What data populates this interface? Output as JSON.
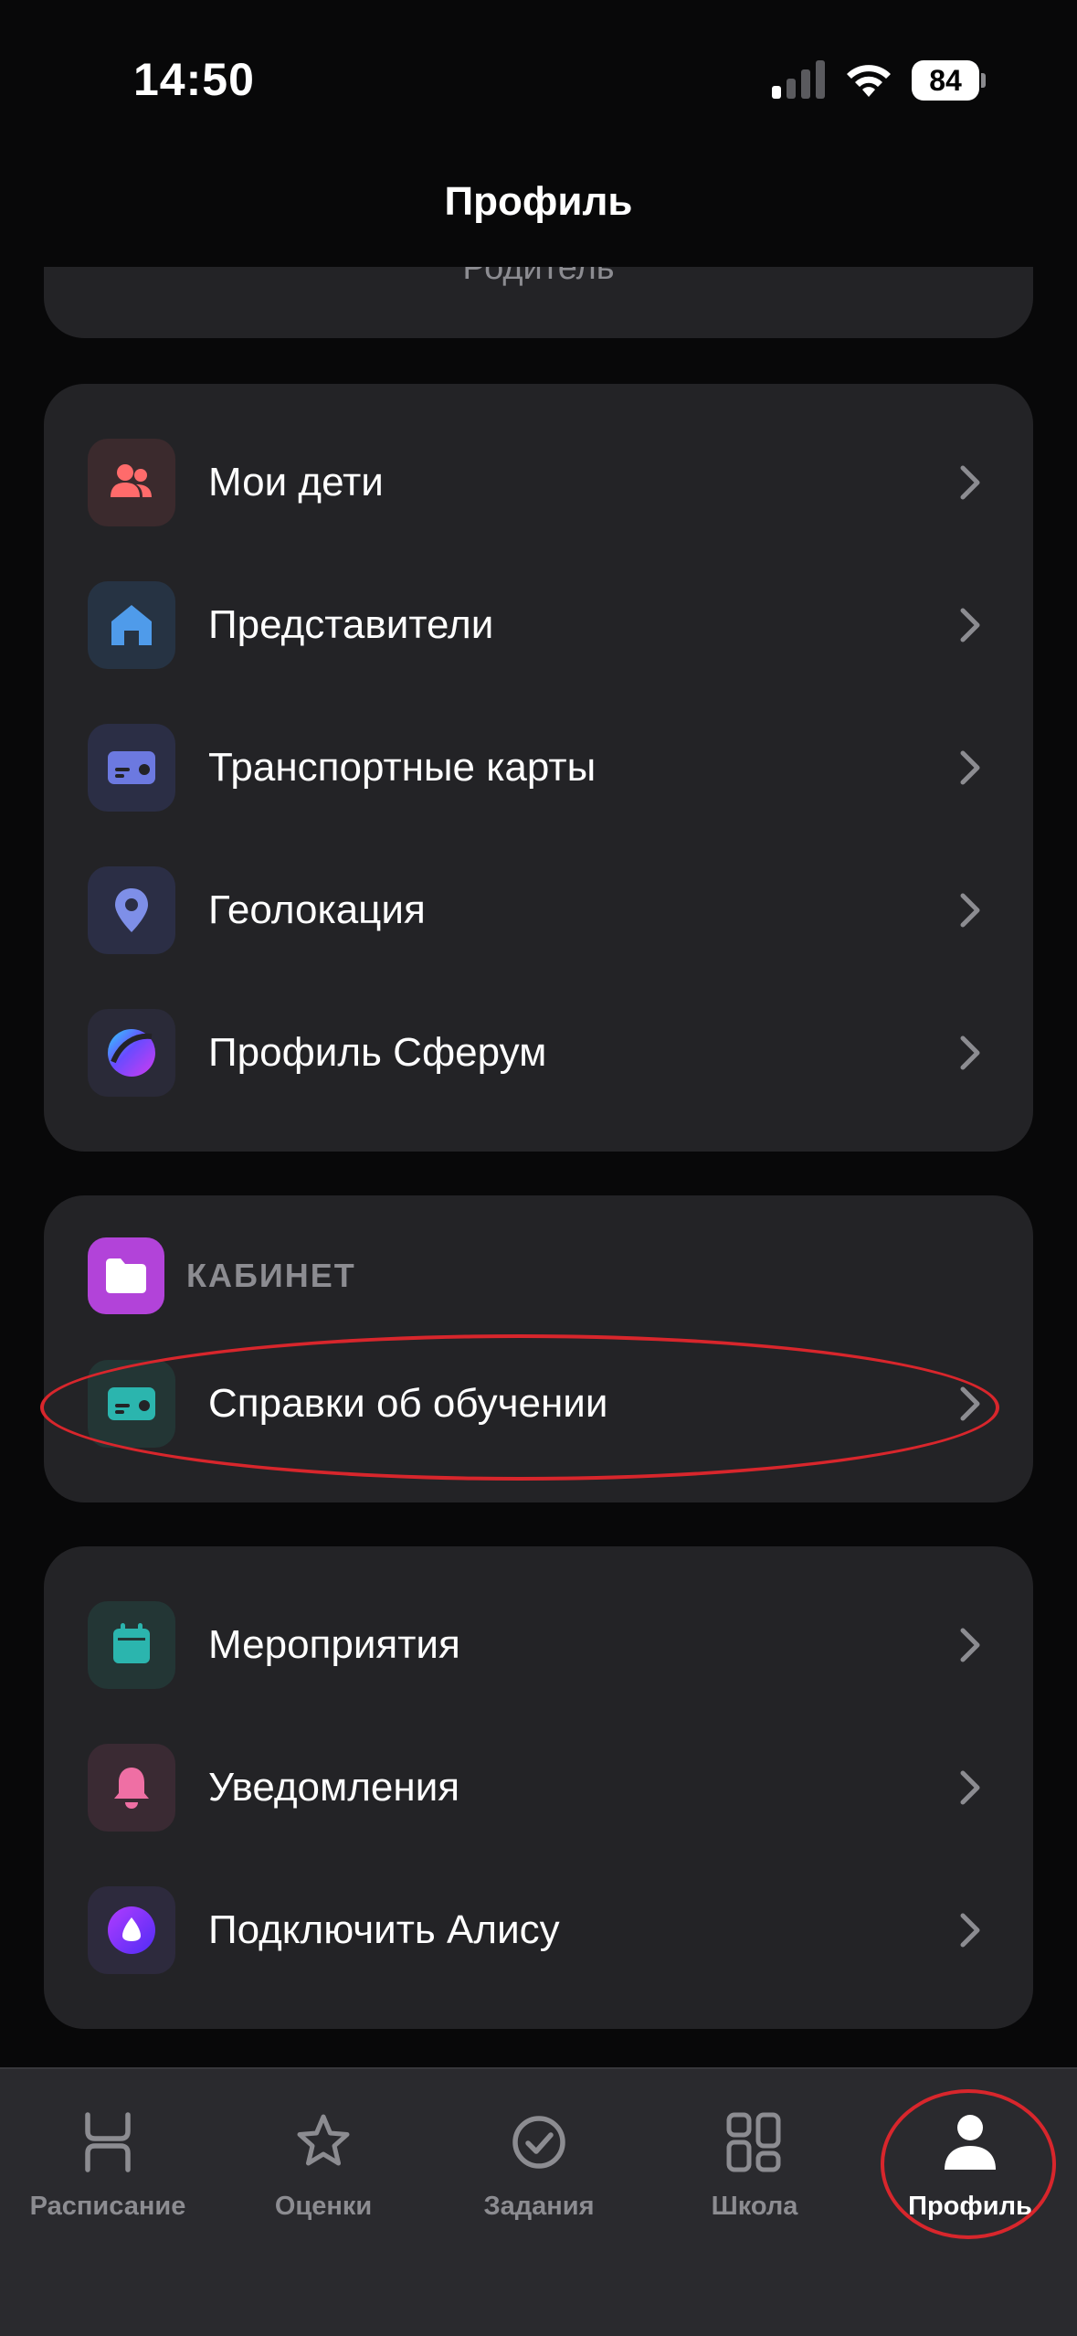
{
  "status_bar": {
    "time": "14:50",
    "battery": "84"
  },
  "header": {
    "title": "Профиль"
  },
  "previous_card": {
    "role": "Родитель"
  },
  "group_main": {
    "items": [
      {
        "label": "Мои дети",
        "icon": "children-icon",
        "color": "#ff6b6b"
      },
      {
        "label": "Представители",
        "icon": "home-icon",
        "color": "#4f9bea"
      },
      {
        "label": "Транспортные карты",
        "icon": "transport-card-icon",
        "color": "#6c79e0"
      },
      {
        "label": "Геолокация",
        "icon": "location-pin-icon",
        "color": "#7e8fe8"
      },
      {
        "label": "Профиль Сферум",
        "icon": "sferum-logo-icon",
        "color": "#7b3cf0"
      }
    ]
  },
  "cabinet": {
    "title": "КАБИНЕТ",
    "icon": "folder-icon",
    "color": "#b243d9",
    "items": [
      {
        "label": "Справки об обучении",
        "icon": "certificate-card-icon",
        "color": "#2bb5ae"
      }
    ]
  },
  "group_other": {
    "items": [
      {
        "label": "Мероприятия",
        "icon": "calendar-icon",
        "color": "#2bb5ae"
      },
      {
        "label": "Уведомления",
        "icon": "bell-icon",
        "color": "#ef6fa4"
      },
      {
        "label": "Подключить Алису",
        "icon": "alice-icon",
        "color": "#7a37f2"
      }
    ]
  },
  "tabbar": {
    "tabs": [
      {
        "label": "Расписание",
        "icon": "schedule-icon"
      },
      {
        "label": "Оценки",
        "icon": "star-icon"
      },
      {
        "label": "Задания",
        "icon": "check-circle-icon"
      },
      {
        "label": "Школа",
        "icon": "school-grid-icon"
      },
      {
        "label": "Профиль",
        "icon": "person-icon",
        "active": true
      }
    ]
  },
  "colors": {
    "background": "#080809",
    "card": "#232326",
    "accent_annotation": "#d8262c",
    "secondary_text": "#8c8c91"
  }
}
